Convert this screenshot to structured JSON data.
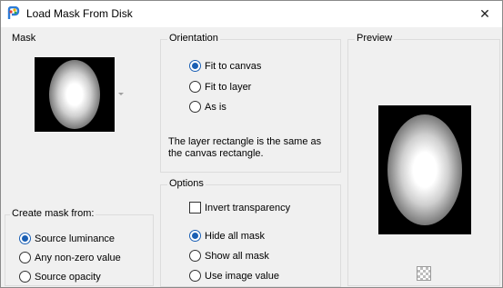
{
  "window": {
    "title": "Load Mask From Disk",
    "close_glyph": "✕"
  },
  "mask": {
    "label": "Mask"
  },
  "create_from": {
    "label": "Create mask from:",
    "options": [
      "Source luminance",
      "Any non-zero value",
      "Source opacity"
    ],
    "selected": "Source luminance"
  },
  "orientation": {
    "label": "Orientation",
    "options": [
      "Fit to canvas",
      "Fit to layer",
      "As is"
    ],
    "selected": "Fit to canvas",
    "note_line1": "The layer rectangle is the same as",
    "note_line2": "the canvas rectangle."
  },
  "options": {
    "label": "Options",
    "invert_label": "Invert transparency",
    "invert_checked": false,
    "mask_modes": [
      "Hide all mask",
      "Show all mask",
      "Use image value"
    ],
    "selected": "Hide all mask"
  },
  "preview": {
    "label": "Preview"
  },
  "colors": {
    "accent": "#1a5fb4",
    "border": "#dcdcdc",
    "dialog_bg": "#f0f0f0"
  }
}
